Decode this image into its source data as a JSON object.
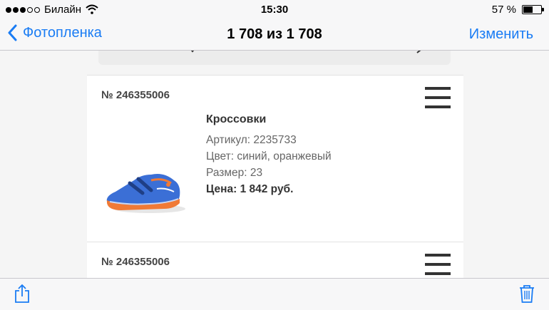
{
  "status_bar": {
    "carrier": "Билайн",
    "time": "15:30",
    "battery_text": "57 %",
    "battery_level": 0.57,
    "signal_icon": "signal-dots-icon",
    "wifi_icon": "wifi-icon",
    "battery_icon": "battery-icon"
  },
  "nav": {
    "back_label": "Фотопленка",
    "title": "1 708 из 1 708",
    "edit_label": "Изменить"
  },
  "items": [
    {
      "order_number": "№ 246355006",
      "title": "Кроссовки",
      "article": "Артикул: 2235733",
      "color": "Цвет: синий, оранжевый",
      "size": "Размер: 23",
      "price": "Цена: 1 842 руб."
    },
    {
      "order_number": "№ 246355006"
    }
  ],
  "toolbar": {
    "share_icon": "share-icon",
    "trash_icon": "trash-icon"
  },
  "colors": {
    "accent": "#1a7cf4",
    "bar_background": "#f7f7f8",
    "content_background": "#f5f5f5"
  }
}
